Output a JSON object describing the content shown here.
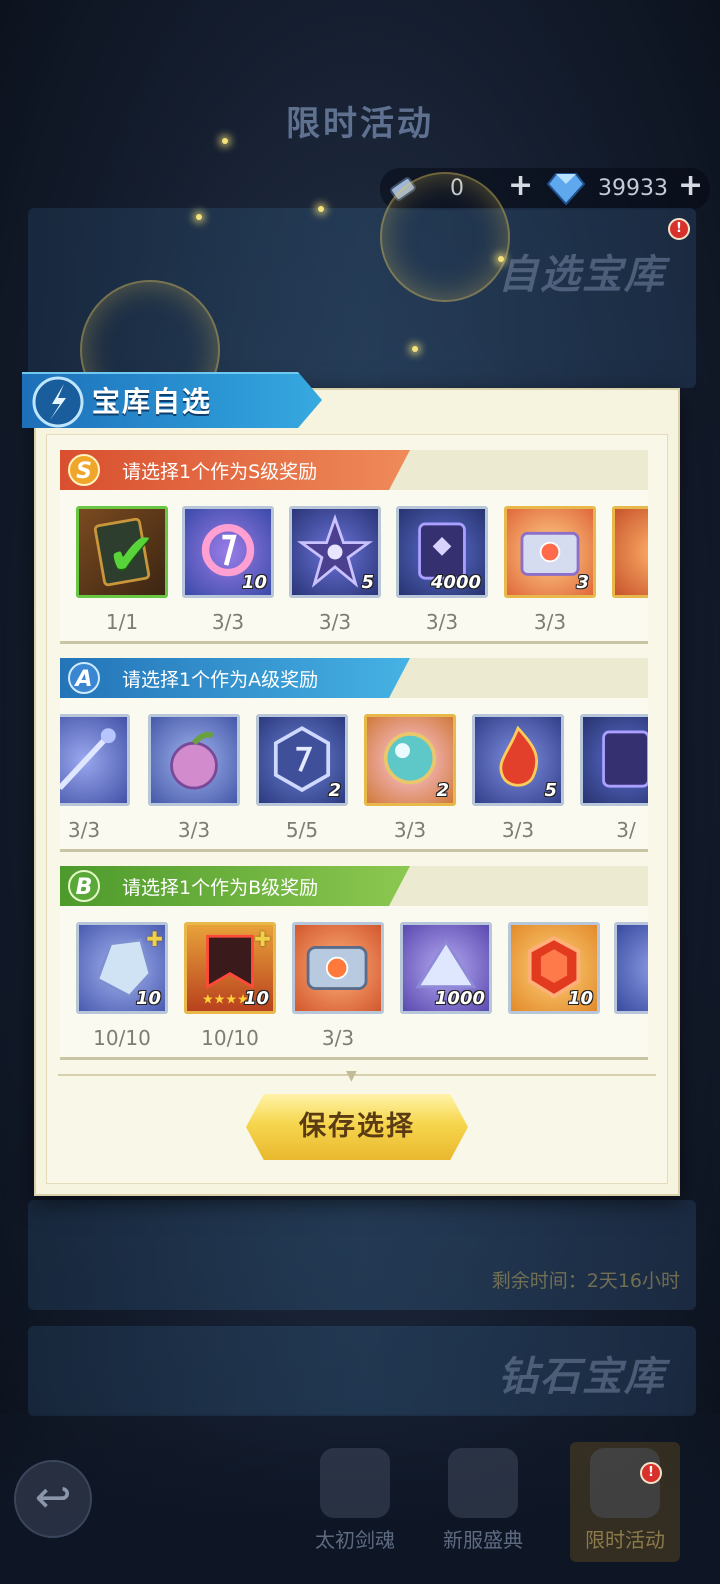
{
  "header": {
    "title": "限时活动"
  },
  "resources": {
    "ticket_value": "0",
    "gem_value": "39933"
  },
  "background": {
    "banner1_title": "自选宝库",
    "banner2_title": "钻石宝库",
    "remaining_time": "剩余时间：2天16小时"
  },
  "bottom_nav": {
    "tabs": [
      {
        "label": "太初剑魂"
      },
      {
        "label": "新服盛典"
      },
      {
        "label": "限时活动"
      }
    ]
  },
  "modal": {
    "title": "宝库自选",
    "sections": [
      {
        "grade": "S",
        "title": "请选择1个作为S级奖励",
        "color": "#e0623a",
        "items": [
          {
            "icon": "selected-card-icon",
            "count": "",
            "progress": "1/1",
            "selected": true
          },
          {
            "icon": "pink-ring-icon",
            "count": "10",
            "progress": "3/3"
          },
          {
            "icon": "star-crystal-icon",
            "count": "5",
            "progress": "3/3"
          },
          {
            "icon": "scroll-icon",
            "count": "4000",
            "progress": "3/3"
          },
          {
            "icon": "gold-chest-icon",
            "count": "3",
            "progress": "3/3"
          }
        ]
      },
      {
        "grade": "A",
        "title": "请选择1个作为A级奖励",
        "color": "#2f8fcf",
        "items": [
          {
            "icon": "staff-icon",
            "count": "",
            "progress": "3/3"
          },
          {
            "icon": "pepper-fruit-icon",
            "count": "",
            "progress": "3/3"
          },
          {
            "icon": "rune-hex-icon",
            "count": "2",
            "progress": "5/5"
          },
          {
            "icon": "crystal-orb-icon",
            "count": "2",
            "progress": "3/3"
          },
          {
            "icon": "flame-icon",
            "count": "5",
            "progress": "3/3"
          },
          {
            "icon": "scroll-icon",
            "count": "",
            "progress": "3/"
          }
        ]
      },
      {
        "grade": "B",
        "title": "请选择1个作为B级奖励",
        "color": "#6bb53d",
        "items": [
          {
            "icon": "ore-crystal-icon",
            "count": "10",
            "progress": "10/10"
          },
          {
            "icon": "dark-banner-icon",
            "count": "10",
            "progress": "10/10"
          },
          {
            "icon": "silver-chest-icon",
            "count": "",
            "progress": "3/3"
          },
          {
            "icon": "purple-shard-icon",
            "count": "1000",
            "progress": ""
          },
          {
            "icon": "red-gem-icon",
            "count": "10",
            "progress": ""
          }
        ]
      }
    ],
    "save_label": "保存选择"
  }
}
